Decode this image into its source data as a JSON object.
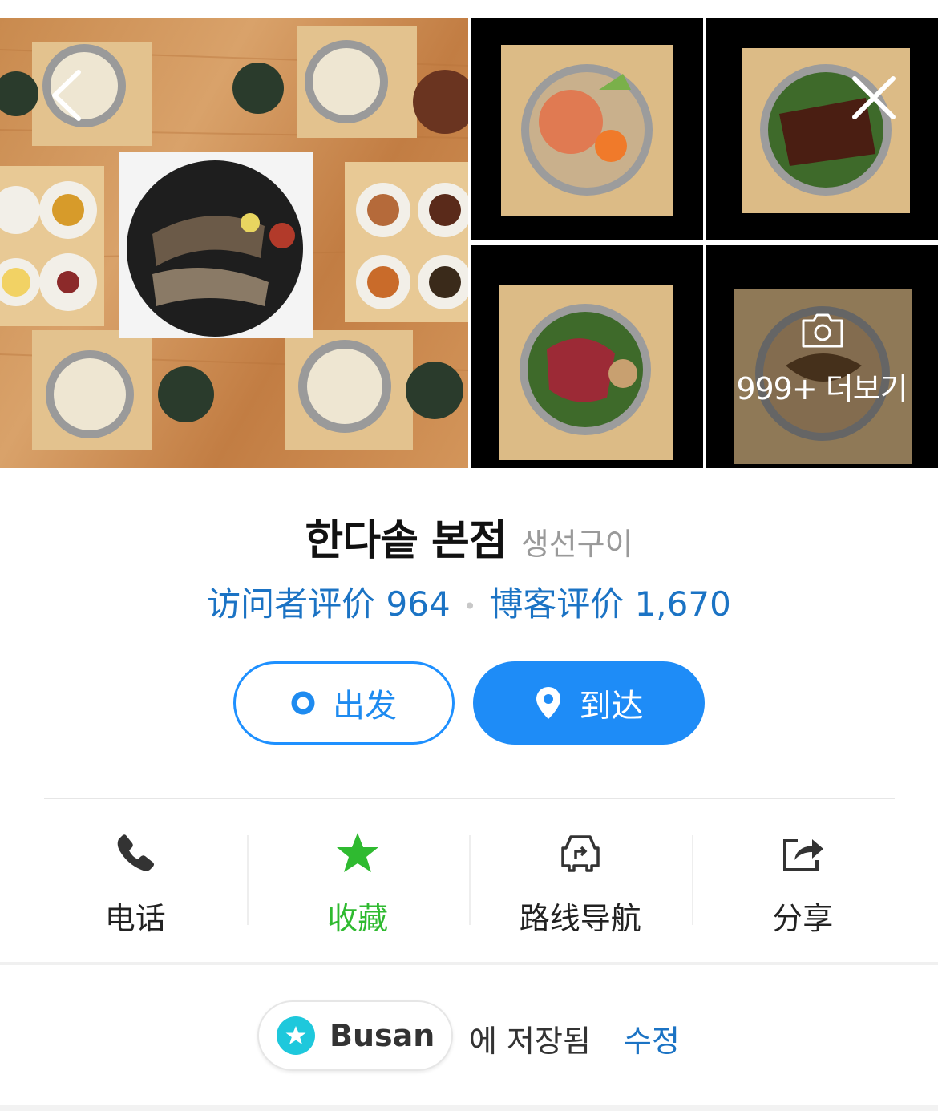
{
  "gallery": {
    "more_label": "999+ 더보기"
  },
  "place": {
    "name": "한다솥 본점",
    "category": "생선구이"
  },
  "reviews": {
    "visitor": "访问者评价 964",
    "separator": "•",
    "blog": "博客评价 1,670"
  },
  "route": {
    "depart_label": "出发",
    "arrive_label": "到达"
  },
  "actions": {
    "call": "电话",
    "favorite": "收藏",
    "directions": "路线导航",
    "share": "分享"
  },
  "saved": {
    "list_name": "Busan",
    "saved_text": "에 저장됨",
    "edit_label": "수정"
  },
  "colors": {
    "accent": "#1e8cf7",
    "link": "#1b73c4",
    "favorite": "#2fba30",
    "list_badge": "#1ec8dc"
  }
}
